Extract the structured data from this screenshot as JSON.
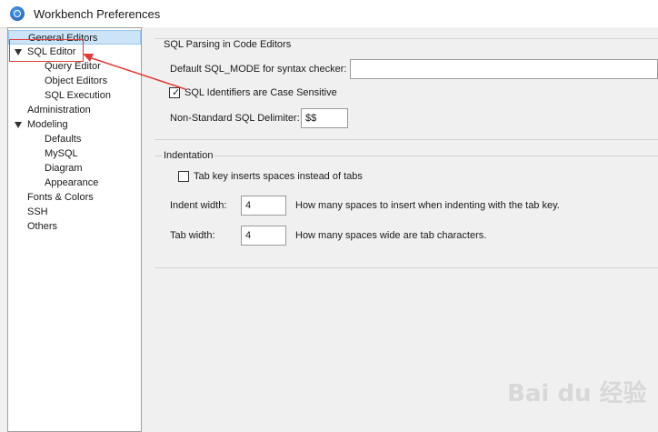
{
  "window": {
    "title": "Workbench Preferences",
    "icon": "mysql-workbench-icon"
  },
  "sidebar": {
    "items": [
      {
        "label": "General Editors",
        "level": 0,
        "selected": true
      },
      {
        "label": "SQL Editor",
        "level": 0,
        "expanded": true
      },
      {
        "label": "Query Editor",
        "level": 1
      },
      {
        "label": "Object Editors",
        "level": 1
      },
      {
        "label": "SQL Execution",
        "level": 1
      },
      {
        "label": "Administration",
        "level": 0
      },
      {
        "label": "Modeling",
        "level": 0,
        "expanded": true
      },
      {
        "label": "Defaults",
        "level": 1
      },
      {
        "label": "MySQL",
        "level": 1
      },
      {
        "label": "Diagram",
        "level": 1
      },
      {
        "label": "Appearance",
        "level": 1
      },
      {
        "label": "Fonts & Colors",
        "level": 0
      },
      {
        "label": "SSH",
        "level": 0
      },
      {
        "label": "Others",
        "level": 0
      }
    ]
  },
  "sql_parsing": {
    "group_title": "SQL Parsing in Code Editors",
    "sql_mode_label": "Default SQL_MODE for syntax checker:",
    "sql_mode_value": "",
    "case_sensitive_label": "SQL Identifiers are Case Sensitive",
    "case_sensitive_checked": true,
    "delimiter_label": "Non-Standard SQL Delimiter:",
    "delimiter_value": "$$"
  },
  "indentation": {
    "group_title": "Indentation",
    "tab_spaces_label": "Tab key inserts spaces instead of tabs",
    "tab_spaces_checked": false,
    "indent_width_label": "Indent width:",
    "indent_width_value": "4",
    "indent_width_hint": "How many spaces to insert when indenting with the tab key.",
    "tab_width_label": "Tab width:",
    "tab_width_value": "4",
    "tab_width_hint": "How many spaces wide are tab characters."
  },
  "annotation": {
    "color": "#e23c3c"
  },
  "watermark": {
    "text": "Bai du 经验"
  },
  "colors": {
    "selection_bg": "#cce4f7",
    "panel_bg": "#f0f0f0"
  }
}
